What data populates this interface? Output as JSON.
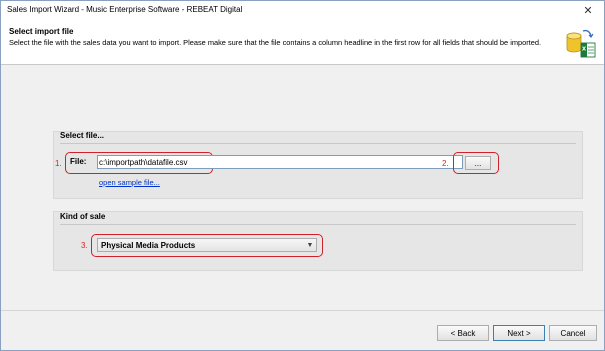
{
  "window": {
    "title": "Sales Import Wizard - Music Enterprise Software - REBEAT Digital",
    "close_glyph": "✕"
  },
  "header": {
    "title": "Select import file",
    "description": "Select the file with the sales data you want to import. Please make sure that the file contains a column headline in the first row for all fields that should be imported.",
    "icon": "database-excel-import-icon"
  },
  "file_group": {
    "label": "Select file...",
    "file_label": "File:",
    "file_value": "c:\\importpath\\datafile.csv",
    "browse_label": "...",
    "sample_link": "open sample file..."
  },
  "kind_group": {
    "label": "Kind of sale",
    "selected": "Physical Media Products"
  },
  "annotations": {
    "step1": "1.",
    "step2": "2.",
    "step3": "3.",
    "color": "#e02020"
  },
  "footer": {
    "back": "< Back",
    "next": "Next >",
    "cancel": "Cancel"
  }
}
